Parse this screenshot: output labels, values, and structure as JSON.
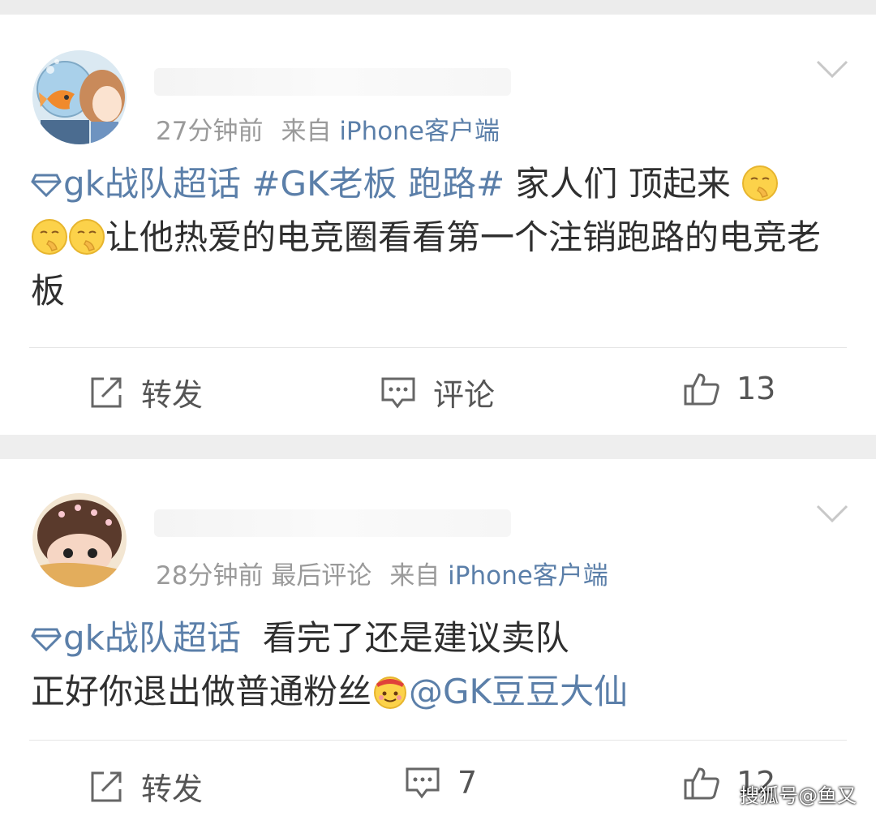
{
  "posts": [
    {
      "meta": {
        "time": "27分钟前",
        "last_comment": "",
        "source_prefix": "来自",
        "source": "iPhone客户端"
      },
      "content": {
        "topic": "gk战队超话",
        "hashtag": "#GK老板 跑路#",
        "text1": " 家人们 顶起来 ",
        "text2": "让他热爱的电竞圈看看第一个注销跑路的电竞老板"
      },
      "actions": {
        "repost_label": "转发",
        "comment_label": "评论",
        "like_count": "13"
      }
    },
    {
      "meta": {
        "time": "28分钟前",
        "last_comment": "最后评论",
        "source_prefix": "来自",
        "source": "iPhone客户端"
      },
      "content": {
        "topic": "gk战队超话",
        "text1": "看完了还是建议卖队",
        "text2": "正好你退出做普通粉丝",
        "mention": "@GK豆豆大仙"
      },
      "actions": {
        "repost_label": "转发",
        "comment_count": "7",
        "like_count": "12"
      }
    }
  ],
  "watermark": "搜狐号@鱼又",
  "colors": {
    "link": "#5b7fa9",
    "meta": "#9a9a9a",
    "text": "#2f2f2f"
  }
}
